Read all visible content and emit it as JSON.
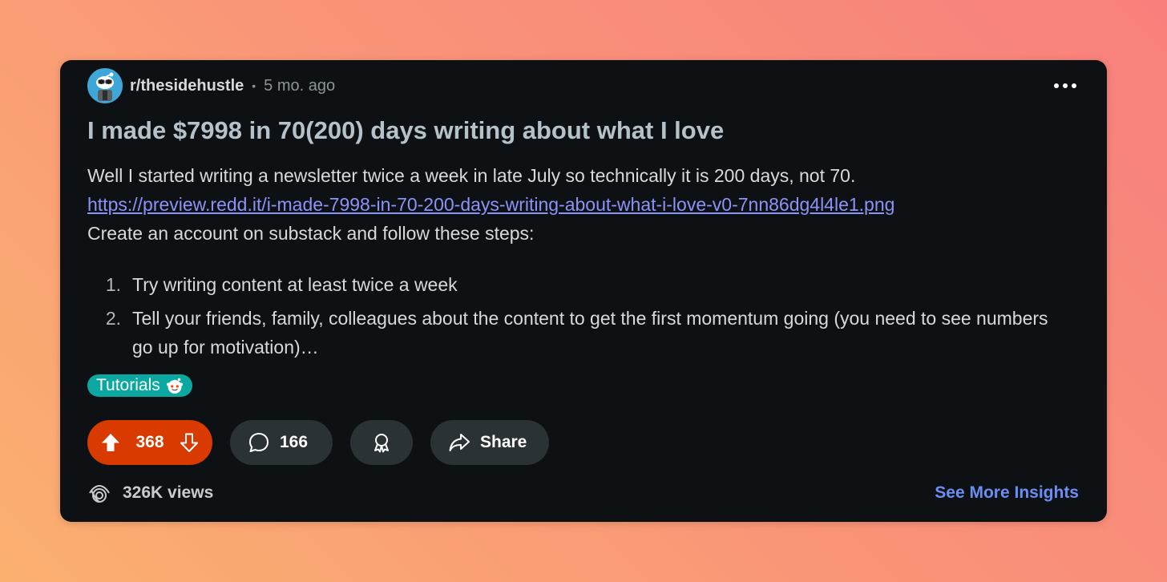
{
  "post": {
    "subreddit": "r/thesidehustle",
    "separator": "•",
    "age": "5 mo. ago",
    "title": "I made $7998 in 70(200) days writing about what I love",
    "body_line1": "Well I started writing a newsletter twice a week in late July so technically it is 200 days, not 70.",
    "link": "https://preview.redd.it/i-made-7998-in-70-200-days-writing-about-what-i-love-v0-7nn86dg4l4le1.png",
    "body_line3": "Create an account on substack and follow these steps:",
    "steps": [
      {
        "num": "1.",
        "text": "Try writing content at least twice a week"
      },
      {
        "num": "2.",
        "text": "Tell your friends, family, colleagues about the content to get the first momentum going (you need to see numbers go up for motivation)…"
      }
    ],
    "flair": "Tutorials"
  },
  "actions": {
    "score": "368",
    "comments": "166",
    "share_label": "Share"
  },
  "footer": {
    "views": "326K views",
    "insights_label": "See More Insights"
  },
  "colors": {
    "card_bg": "#0e1113",
    "upvote_bg": "#d93a00",
    "pill_bg": "#2a3236",
    "flair_bg": "#0aa8a0",
    "link": "#8b93f8",
    "insights": "#6b8ef5"
  },
  "icons": {
    "menu": "more-horizontal-icon",
    "upvote": "arrow-up-icon",
    "downvote": "arrow-down-icon",
    "comment": "comment-bubble-icon",
    "award": "award-icon",
    "share": "share-arrow-icon",
    "views": "views-eye-icon",
    "flair": "snoo-icon"
  }
}
